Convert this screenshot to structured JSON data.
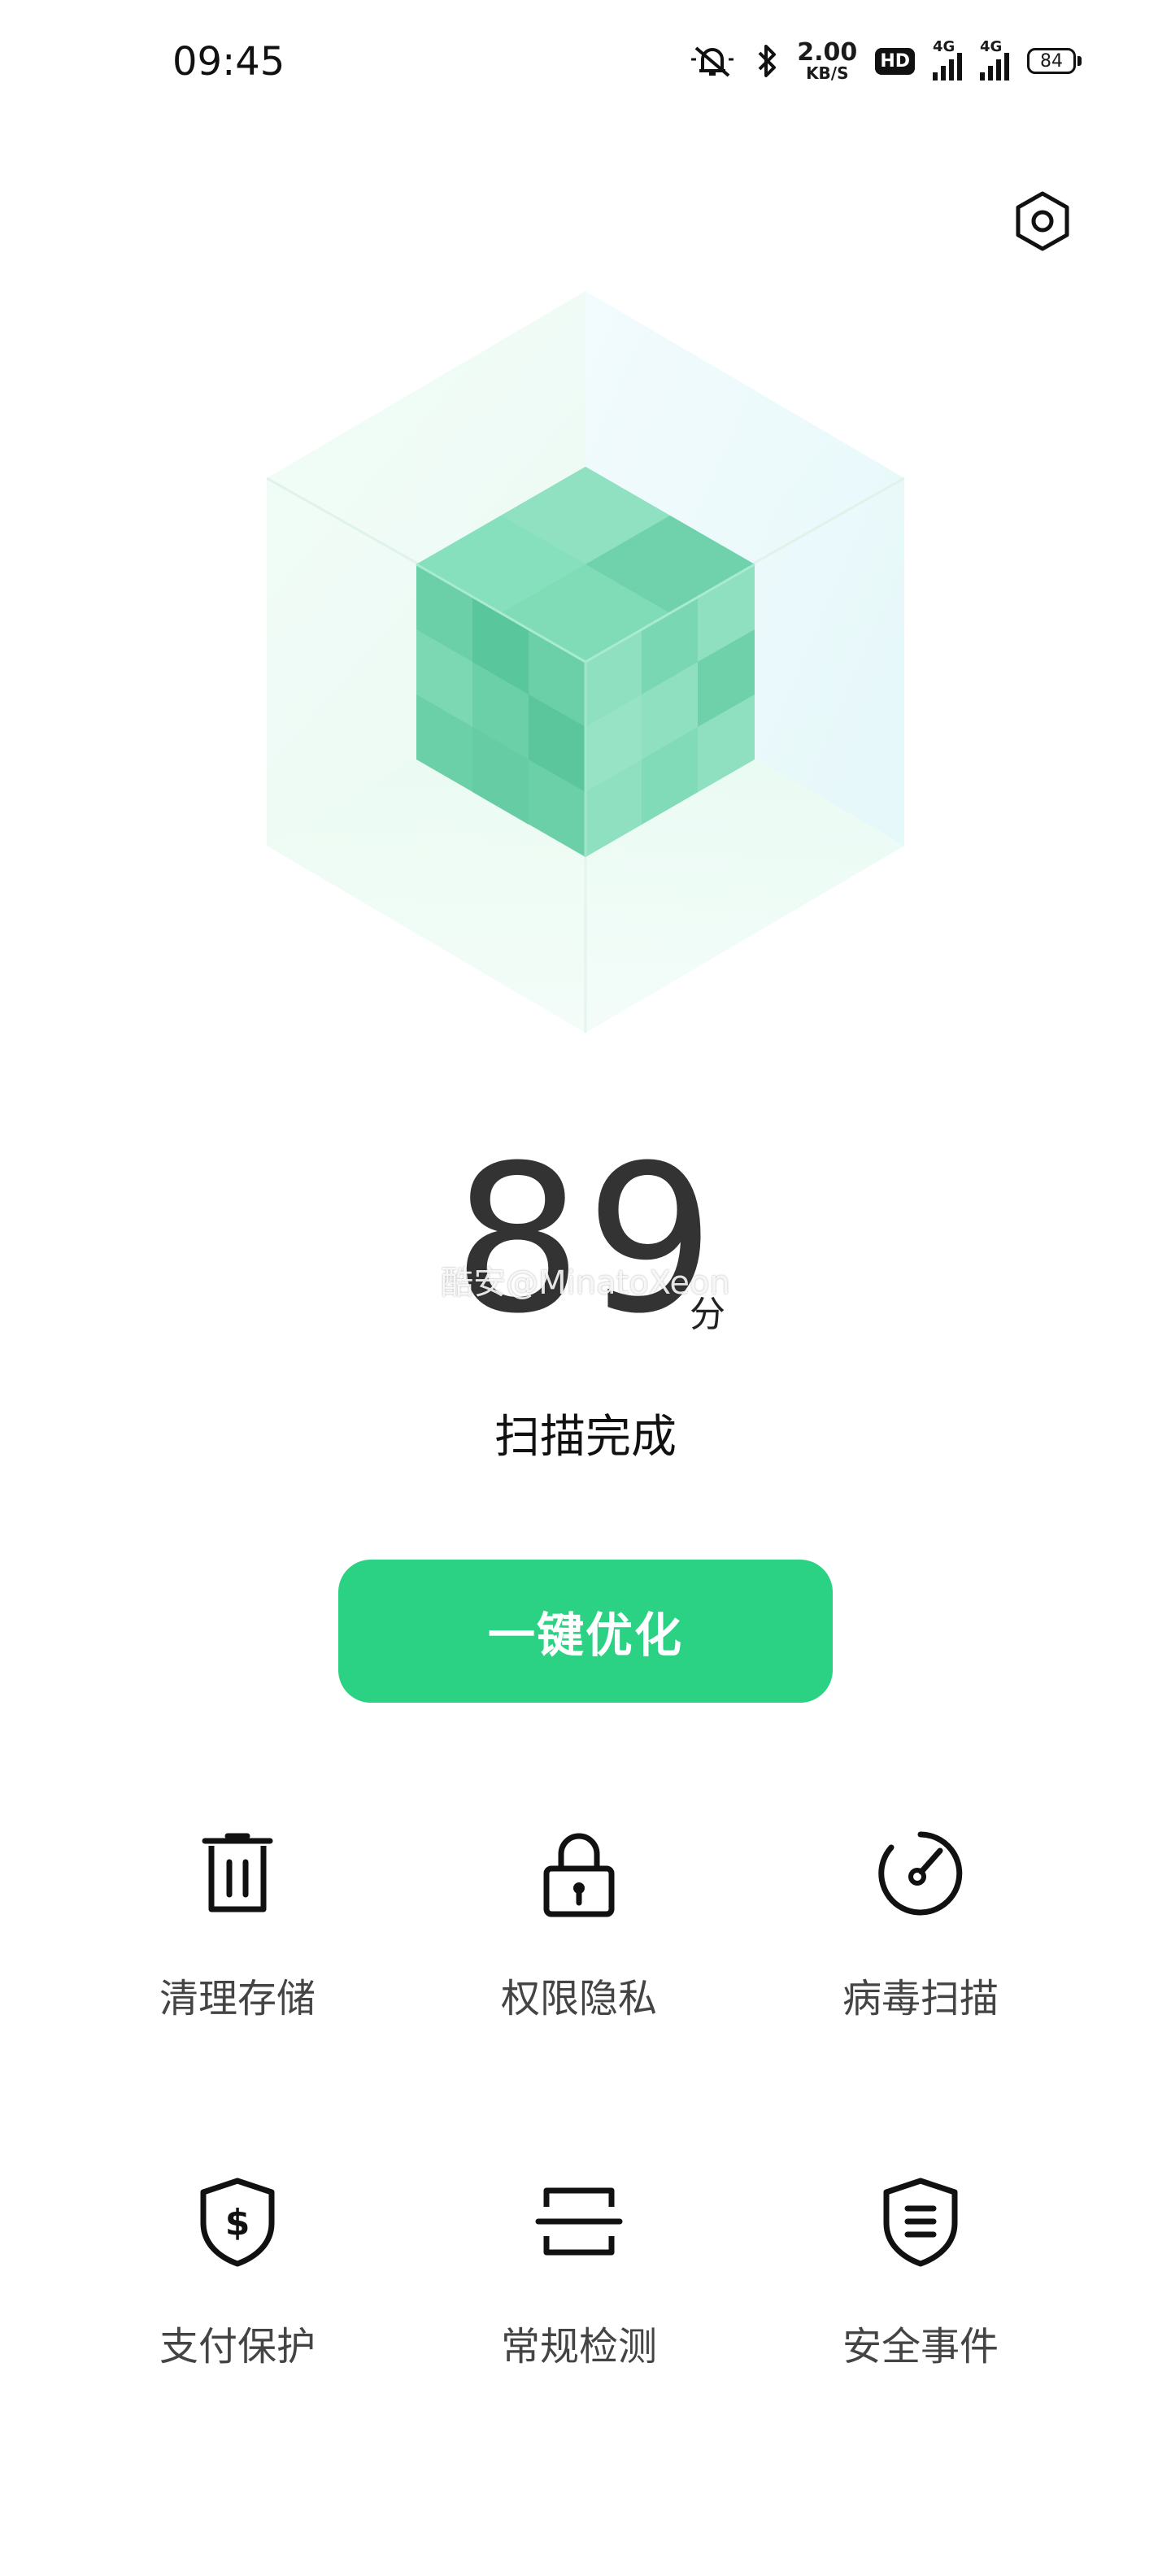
{
  "status_bar": {
    "time": "09:45",
    "icons": [
      "bell-off-icon",
      "bluetooth-icon",
      "hd-icon",
      "signal-icon",
      "signal-icon",
      "battery-icon"
    ],
    "speed_value": "2.00",
    "speed_unit": "KB/S",
    "hd_label": "HD",
    "sim1_label": "4G",
    "sim2_label": "4G",
    "battery": "84"
  },
  "header": {
    "settings_icon": "settings-hexagon-icon"
  },
  "hero": {
    "illustration": "cube-icon",
    "colors": {
      "cube_green": "#5fd3a3",
      "frame_tint": "#d9f5ec"
    }
  },
  "score": {
    "value": "89",
    "unit": "分",
    "watermark": "酷安@MinatoXeon"
  },
  "scan_status": "扫描完成",
  "optimize_button": {
    "label": "一键优化",
    "color": "#2cd283"
  },
  "tools": [
    {
      "icon": "trash-icon",
      "label": "清理存储"
    },
    {
      "icon": "lock-icon",
      "label": "权限隐私"
    },
    {
      "icon": "gauge-icon",
      "label": "病毒扫描"
    },
    {
      "icon": "shield-dollar-icon",
      "label": "支付保护"
    },
    {
      "icon": "scan-icon",
      "label": "常规检测"
    },
    {
      "icon": "shield-list-icon",
      "label": "安全事件"
    }
  ]
}
